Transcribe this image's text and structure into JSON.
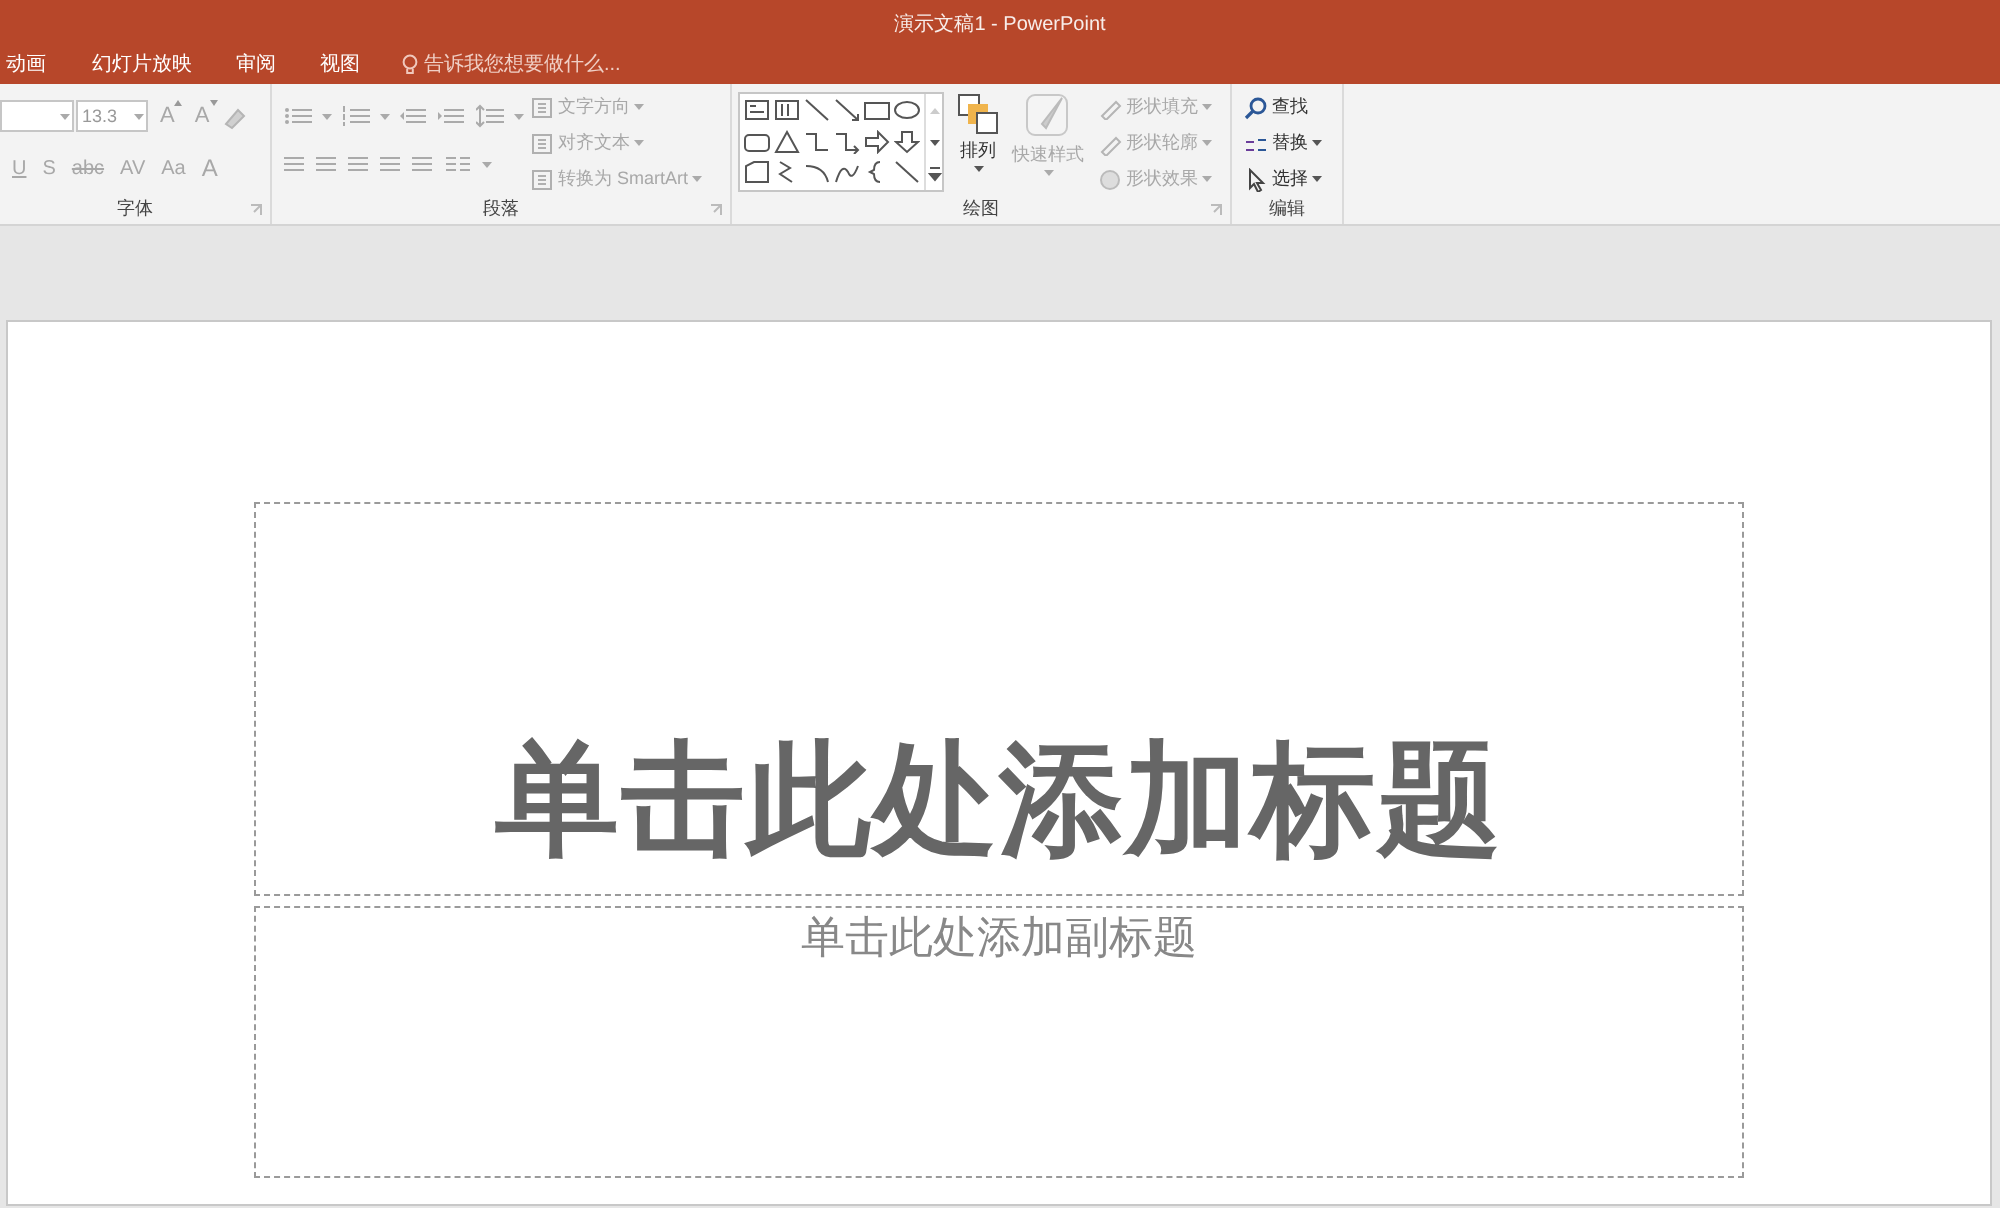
{
  "window": {
    "title": "演示文稿1 - PowerPoint"
  },
  "tabs": [
    {
      "label": "动画",
      "selected": false
    },
    {
      "label": "幻灯片放映",
      "selected": false
    },
    {
      "label": "审阅",
      "selected": false
    },
    {
      "label": "视图",
      "selected": false
    }
  ],
  "tell_me": {
    "placeholder": "告诉我您想要做什么..."
  },
  "ribbon": {
    "font": {
      "label": "字体",
      "font_size": "13.3",
      "row1": [
        {
          "glyph": "A",
          "kind": "grow",
          "disabled": true
        },
        {
          "glyph": "A",
          "kind": "shrink",
          "disabled": true
        }
      ],
      "row2": [
        {
          "glyph": "U",
          "kind": "underline",
          "disabled": true
        },
        {
          "glyph": "S",
          "kind": "shadow",
          "disabled": true
        },
        {
          "glyph": "abc",
          "kind": "strike",
          "disabled": true
        },
        {
          "glyph": "AV",
          "kind": "spacing",
          "disabled": true
        },
        {
          "glyph": "Aa",
          "kind": "case",
          "disabled": true
        },
        {
          "glyph": "A",
          "kind": "color",
          "disabled": true
        }
      ]
    },
    "paragraph": {
      "label": "段落",
      "commands": [
        {
          "label": "文字方向",
          "disabled": true
        },
        {
          "label": "对齐文本",
          "disabled": true
        },
        {
          "label": "转换为 SmartArt",
          "disabled": true
        }
      ]
    },
    "drawing": {
      "label": "绘图",
      "arrange": {
        "label": "排列",
        "disabled": false
      },
      "quick_styles": {
        "label": "快速样式",
        "disabled": true
      },
      "commands": [
        {
          "label": "形状填充",
          "disabled": true
        },
        {
          "label": "形状轮廓",
          "disabled": true
        },
        {
          "label": "形状效果",
          "disabled": true
        }
      ]
    },
    "editing": {
      "label": "编辑",
      "commands": [
        {
          "label": "查找",
          "disabled": false
        },
        {
          "label": "替换",
          "disabled": false
        },
        {
          "label": "选择",
          "disabled": false
        }
      ]
    }
  },
  "slide": {
    "title_placeholder": "单击此处添加标题",
    "subtitle_placeholder": "单击此处添加副标题"
  }
}
